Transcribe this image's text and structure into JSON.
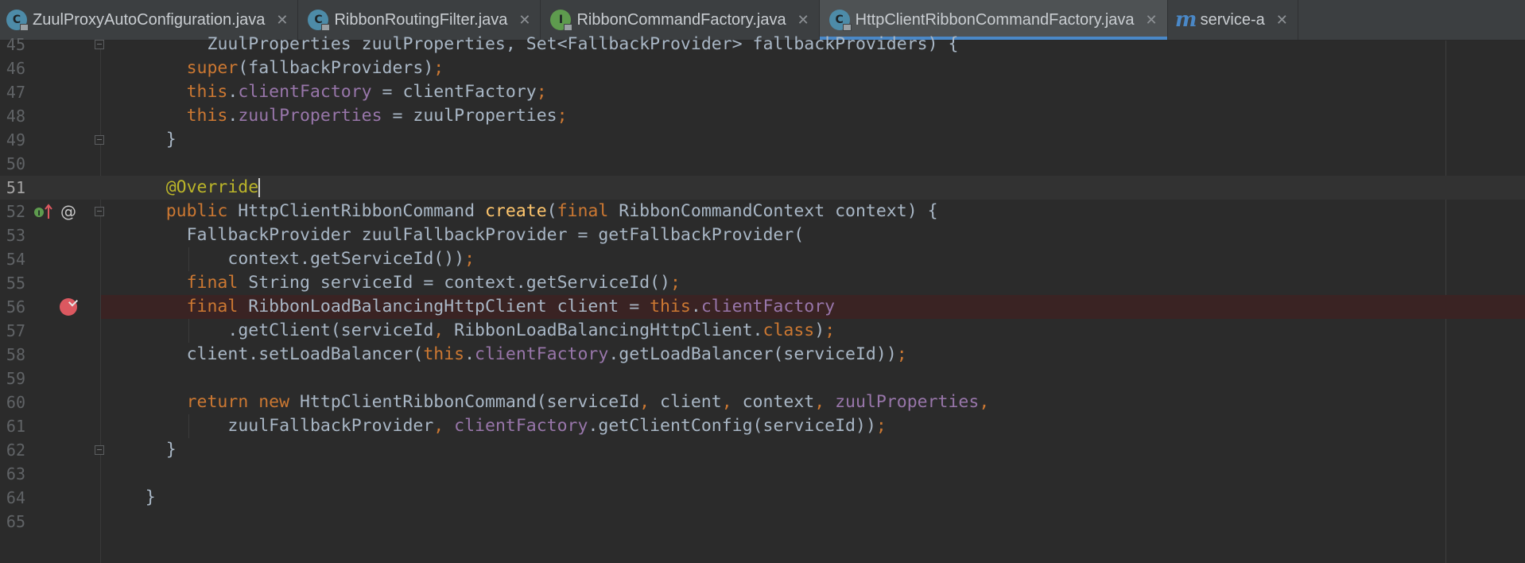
{
  "tabs": [
    {
      "label": "ZuulProxyAutoConfiguration.java",
      "icon": "class-icon",
      "icon_letter": "C",
      "locked": true,
      "active": false
    },
    {
      "label": "RibbonRoutingFilter.java",
      "icon": "class-icon",
      "icon_letter": "C",
      "locked": true,
      "active": false
    },
    {
      "label": "RibbonCommandFactory.java",
      "icon": "interface-icon",
      "icon_letter": "I",
      "locked": true,
      "active": false
    },
    {
      "label": "HttpClientRibbonCommandFactory.java",
      "icon": "class-icon",
      "icon_letter": "C",
      "locked": true,
      "active": true
    },
    {
      "label": "service-a",
      "icon": "maven-icon",
      "icon_letter": "m",
      "locked": false,
      "active": false
    }
  ],
  "tab_close_glyph": "✕",
  "colors": {
    "keyword": "#cc7832",
    "field": "#9876aa",
    "method": "#ffc66d",
    "annotation": "#bbb529",
    "text": "#a9b7c6",
    "breakpoint": "#db5860",
    "active_tab_underline": "#4a88c7"
  },
  "gutter": {
    "override_marker": {
      "line": 52,
      "icon": "implements-method-icon"
    },
    "annotation_marker": {
      "line": 52,
      "glyph": "@"
    },
    "breakpoint": {
      "line": 56,
      "icon": "breakpoint-verified-icon"
    }
  },
  "caret_line": 51,
  "lines": [
    {
      "num": "45",
      "indent": 10,
      "tokens": [
        [
          "t",
          "ZuulProperties zuulProperties, Set<FallbackProvider> fallbackProviders) {"
        ]
      ]
    },
    {
      "num": "46",
      "indent": 8,
      "tokens": [
        [
          "kw",
          "super"
        ],
        [
          "t",
          "(fallbackProviders)"
        ],
        [
          "kw",
          ";"
        ]
      ]
    },
    {
      "num": "47",
      "indent": 8,
      "tokens": [
        [
          "kw",
          "this"
        ],
        [
          "t",
          "."
        ],
        [
          "field",
          "clientFactory"
        ],
        [
          "t",
          " = clientFactory"
        ],
        [
          "kw",
          ";"
        ]
      ]
    },
    {
      "num": "48",
      "indent": 8,
      "tokens": [
        [
          "kw",
          "this"
        ],
        [
          "t",
          "."
        ],
        [
          "field",
          "zuulProperties"
        ],
        [
          "t",
          " = zuulProperties"
        ],
        [
          "kw",
          ";"
        ]
      ]
    },
    {
      "num": "49",
      "indent": 6,
      "tokens": [
        [
          "t",
          "}"
        ]
      ]
    },
    {
      "num": "50",
      "indent": 0,
      "tokens": []
    },
    {
      "num": "51",
      "indent": 6,
      "tokens": [
        [
          "annotation",
          "@Override"
        ]
      ]
    },
    {
      "num": "52",
      "indent": 6,
      "tokens": [
        [
          "kw",
          "public "
        ],
        [
          "t",
          "HttpClientRibbonCommand "
        ],
        [
          "method",
          "create"
        ],
        [
          "t",
          "("
        ],
        [
          "kw",
          "final "
        ],
        [
          "t",
          "RibbonCommandContext context) {"
        ]
      ]
    },
    {
      "num": "53",
      "indent": 8,
      "tokens": [
        [
          "t",
          "FallbackProvider zuulFallbackProvider = getFallbackProvider("
        ]
      ]
    },
    {
      "num": "54",
      "indent": 12,
      "tokens": [
        [
          "t",
          "context.getServiceId())"
        ],
        [
          "kw",
          ";"
        ]
      ]
    },
    {
      "num": "55",
      "indent": 8,
      "tokens": [
        [
          "kw",
          "final "
        ],
        [
          "t",
          "String serviceId = context.getServiceId()"
        ],
        [
          "kw",
          ";"
        ]
      ]
    },
    {
      "num": "56",
      "indent": 8,
      "tokens": [
        [
          "kw",
          "final "
        ],
        [
          "t",
          "RibbonLoadBalancingHttpClient client = "
        ],
        [
          "kw",
          "this"
        ],
        [
          "t",
          "."
        ],
        [
          "field",
          "clientFactory"
        ]
      ]
    },
    {
      "num": "57",
      "indent": 12,
      "tokens": [
        [
          "t",
          ".getClient(serviceId"
        ],
        [
          "kw",
          ", "
        ],
        [
          "t",
          "RibbonLoadBalancingHttpClient."
        ],
        [
          "kw",
          "class"
        ],
        [
          "t",
          ")"
        ],
        [
          "kw",
          ";"
        ]
      ]
    },
    {
      "num": "58",
      "indent": 8,
      "tokens": [
        [
          "t",
          "client.setLoadBalancer("
        ],
        [
          "kw",
          "this"
        ],
        [
          "t",
          "."
        ],
        [
          "field",
          "clientFactory"
        ],
        [
          "t",
          ".getLoadBalancer(serviceId))"
        ],
        [
          "kw",
          ";"
        ]
      ]
    },
    {
      "num": "59",
      "indent": 0,
      "tokens": []
    },
    {
      "num": "60",
      "indent": 8,
      "tokens": [
        [
          "kw",
          "return new "
        ],
        [
          "t",
          "HttpClientRibbonCommand(serviceId"
        ],
        [
          "kw",
          ", "
        ],
        [
          "t",
          "client"
        ],
        [
          "kw",
          ", "
        ],
        [
          "t",
          "context"
        ],
        [
          "kw",
          ", "
        ],
        [
          "field",
          "zuulProperties"
        ],
        [
          "kw",
          ","
        ]
      ]
    },
    {
      "num": "61",
      "indent": 12,
      "tokens": [
        [
          "t",
          "zuulFallbackProvider"
        ],
        [
          "kw",
          ", "
        ],
        [
          "field",
          "clientFactory"
        ],
        [
          "t",
          ".getClientConfig(serviceId))"
        ],
        [
          "kw",
          ";"
        ]
      ]
    },
    {
      "num": "62",
      "indent": 6,
      "tokens": [
        [
          "t",
          "}"
        ]
      ]
    },
    {
      "num": "63",
      "indent": 0,
      "tokens": []
    },
    {
      "num": "64",
      "indent": 4,
      "tokens": [
        [
          "t",
          "}"
        ]
      ]
    },
    {
      "num": "65",
      "indent": 0,
      "tokens": []
    }
  ]
}
